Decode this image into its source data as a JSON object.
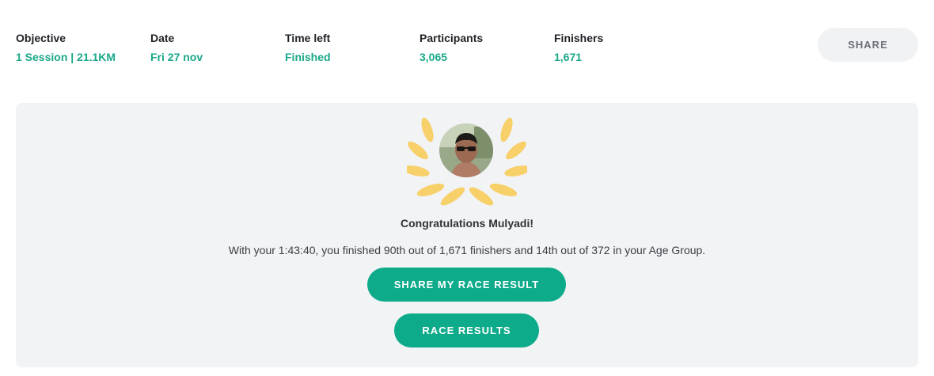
{
  "stats": [
    {
      "label": "Objective",
      "value": "1 Session | 21.1KM"
    },
    {
      "label": "Date",
      "value": "Fri 27 nov"
    },
    {
      "label": "Time left",
      "value": "Finished"
    },
    {
      "label": "Participants",
      "value": "3,065"
    },
    {
      "label": "Finishers",
      "value": "1,671"
    }
  ],
  "header": {
    "share_label": "SHARE"
  },
  "result": {
    "congrats": "Congratulations Mulyadi!",
    "summary": "With your 1:43:40, you finished 90th out of 1,671 finishers and 14th out of 372 in your Age Group.",
    "share_result_label": "SHARE MY RACE RESULT",
    "race_results_label": "RACE RESULTS"
  },
  "icons": {
    "wreath": "laurel-wreath-icon",
    "avatar": "user-avatar"
  },
  "colors": {
    "accent": "#0eab8b",
    "stat_value": "#1aa888",
    "wreath": "#f7d06a",
    "panel_bg": "#f2f3f5"
  }
}
